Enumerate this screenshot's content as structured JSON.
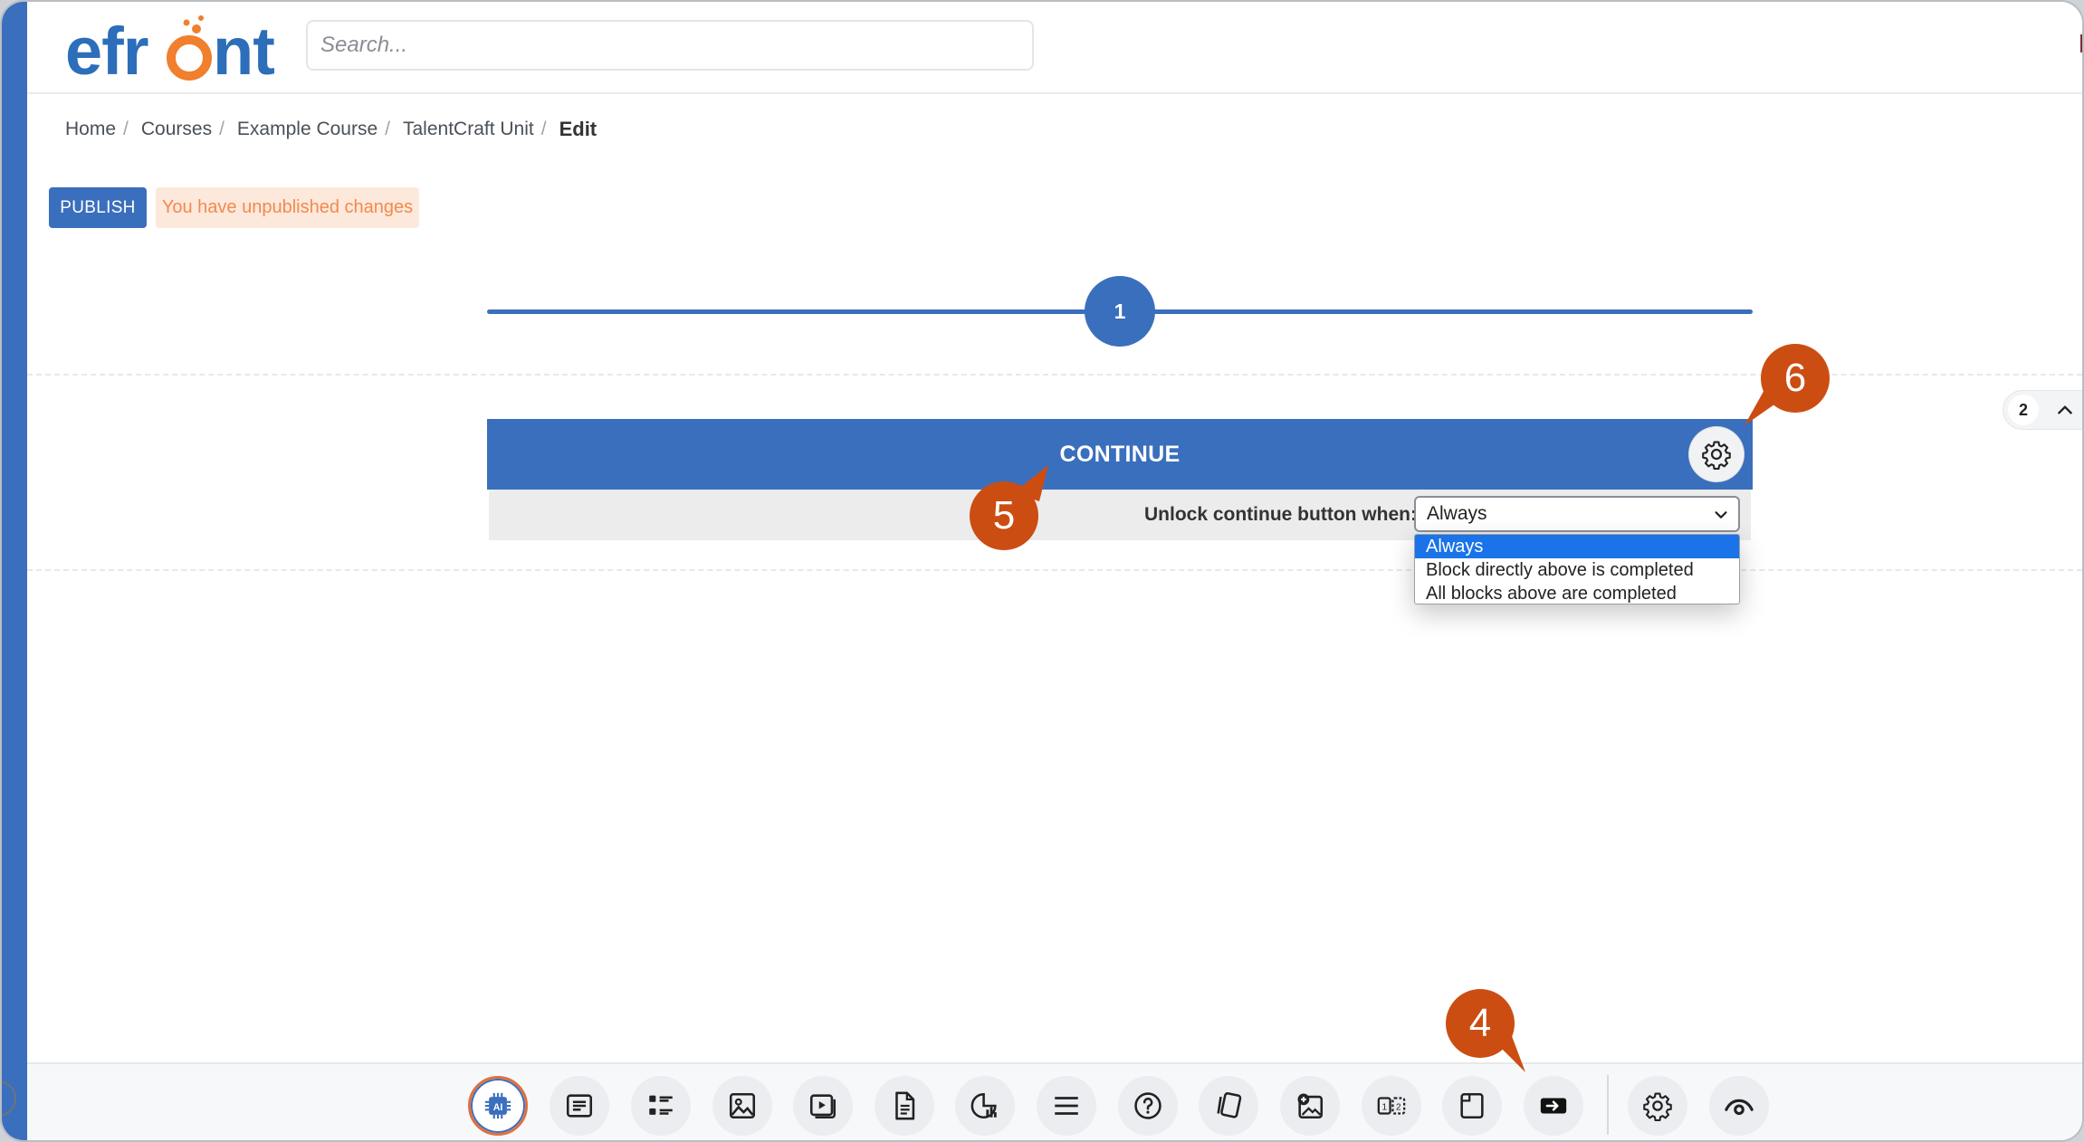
{
  "header": {
    "logo_text": "efront",
    "search_placeholder": "Search..."
  },
  "breadcrumb": {
    "items": [
      "Home",
      "Courses",
      "Example Course",
      "TalentCraft Unit"
    ],
    "current": "Edit",
    "separator": "/"
  },
  "actions": {
    "publish_label": "PUBLISH",
    "unpublished_notice": "You have unpublished changes"
  },
  "stepper": {
    "current_step": "1"
  },
  "continue_block": {
    "button_label": "CONTINUE",
    "unlock_label": "Unlock continue button when:",
    "selected": "Always",
    "options": [
      "Always",
      "Block directly above is completed",
      "All blocks above are completed"
    ]
  },
  "page_indicator": {
    "page": "2"
  },
  "toolbar": {
    "icons": [
      "ai-icon",
      "text-icon",
      "list-icon",
      "image-icon",
      "video-icon",
      "document-icon",
      "chart-icon",
      "divider-icon",
      "question-icon",
      "flashcards-icon",
      "image-hotspot-icon",
      "comparison-icon",
      "embed-icon",
      "continue-icon",
      "settings-icon",
      "preview-icon"
    ]
  },
  "callouts": [
    "4",
    "5",
    "6"
  ],
  "colors": {
    "primary": "#3a6fbd",
    "accent": "#f07f2e",
    "callout": "#cc4d12",
    "notice_bg": "#fde8dc",
    "notice_text": "#f28a4d",
    "option_selected": "#1a73e8"
  }
}
